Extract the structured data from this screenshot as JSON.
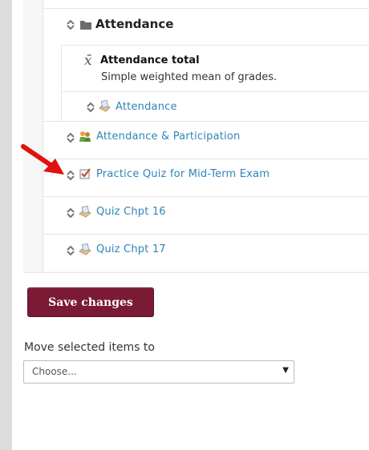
{
  "gradebook": {
    "category": {
      "name": "Attendance",
      "total": {
        "symbol": "x̄",
        "title": "Attendance total",
        "description": "Simple weighted mean of grades."
      },
      "items": [
        {
          "label": "Attendance",
          "icon": "assignment-icon"
        }
      ]
    },
    "items": [
      {
        "label": "Attendance & Participation",
        "icon": "attendance-icon"
      },
      {
        "label": "Practice Quiz for Mid-Term Exam",
        "icon": "quiz-check-icon"
      },
      {
        "label": "Quiz Chpt 16",
        "icon": "quiz-icon"
      },
      {
        "label": "Quiz Chpt 17",
        "icon": "quiz-icon"
      }
    ]
  },
  "actions": {
    "save_label": "Save changes",
    "move_label": "Move selected items to",
    "move_select_value": "Choose..."
  },
  "annotation": {
    "arrow_color": "#e0120f"
  },
  "colors": {
    "link": "#2e85b8",
    "save_button": "#7b1a35"
  }
}
